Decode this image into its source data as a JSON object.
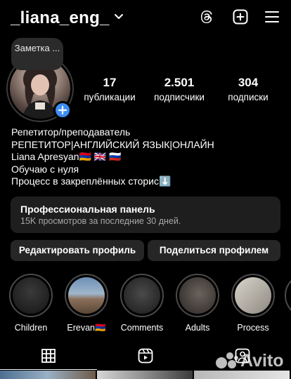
{
  "header": {
    "username": "_liana_eng_",
    "icons": [
      "threads-icon",
      "plus-square-icon",
      "menu-icon"
    ]
  },
  "profile": {
    "note": "Заметка ...",
    "stats": [
      {
        "num": "17",
        "label": "публикации"
      },
      {
        "num": "2.501",
        "label": "подписчики"
      },
      {
        "num": "304",
        "label": "подписки"
      }
    ]
  },
  "bio": {
    "category": "Репетитор/преподаватель",
    "line1": "РЕПЕТИТОР|АНГЛИЙСКИЙ ЯЗЫК|ОНЛАЙН",
    "line2": "Liana Apresyan🇦🇲 🇬🇧 🇷🇺",
    "line3": "Обучаю с нуля",
    "line4": "Процесс в закреплённых сторис⬇️"
  },
  "panel": {
    "title": "Профессиональная панель",
    "subtitle": "15K просмотров за последние 30 дней."
  },
  "buttons": {
    "edit": "Редактировать профиль",
    "share": "Поделиться профилем"
  },
  "highlights": [
    {
      "label": "Children"
    },
    {
      "label": "Erevan🇦🇲"
    },
    {
      "label": "Comments"
    },
    {
      "label": "Adults"
    },
    {
      "label": "Process"
    }
  ],
  "tabs": [
    "grid-icon",
    "reels-icon",
    "tagged-icon"
  ],
  "watermark": "Avito",
  "colors": {
    "accent": "#3d8ef2",
    "panel_bg": "#1e1e1e",
    "button_bg": "#262626"
  }
}
